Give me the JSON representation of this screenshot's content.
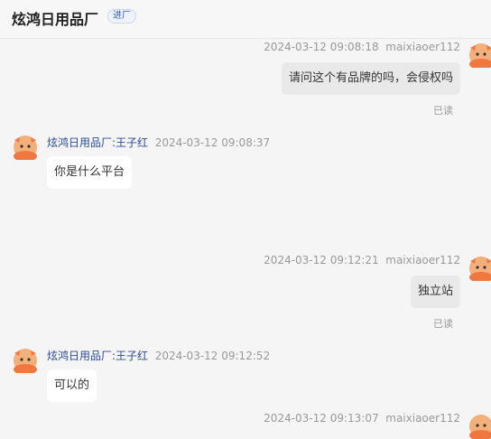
{
  "header": {
    "title": "炫鸿日用品厂",
    "tag": "进厂"
  },
  "messages": [
    {
      "side": "right",
      "time": "2024-03-12 09:08:18",
      "sender": "maixiaoer112",
      "text": "请问这个有品牌的吗，会侵权吗",
      "status": "已读"
    },
    {
      "side": "left",
      "time": "2024-03-12 09:08:37",
      "sender": "炫鸿日用品厂:王子红",
      "text": "你是什么平台"
    },
    {
      "side": "right",
      "time": "2024-03-12 09:12:21",
      "sender": "maixiaoer112",
      "text": "独立站",
      "status": "已读"
    },
    {
      "side": "left",
      "time": "2024-03-12 09:12:52",
      "sender": "炫鸿日用品厂:王子红",
      "text": "可以的"
    },
    {
      "side": "right",
      "time": "2024-03-12 09:13:07",
      "sender": "maixiaoer112",
      "text": ""
    }
  ],
  "icons": {
    "avatar": "cartoon-character-avatar-icon"
  }
}
